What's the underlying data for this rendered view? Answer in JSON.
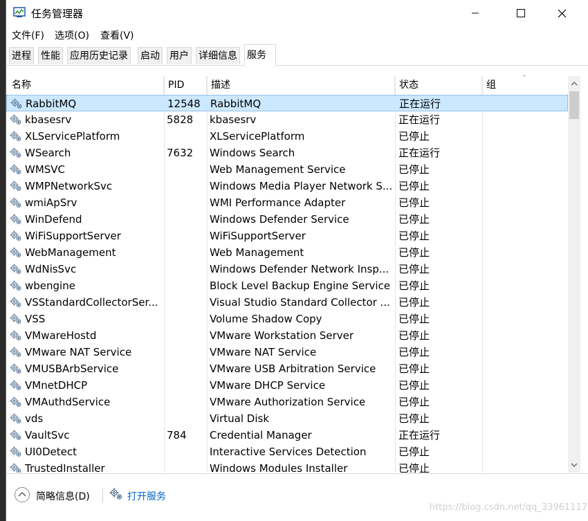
{
  "window": {
    "title": "任务管理器"
  },
  "menu": [
    {
      "label": "文件(F)"
    },
    {
      "label": "选项(O)"
    },
    {
      "label": "查看(V)"
    }
  ],
  "tabs": [
    {
      "label": "进程"
    },
    {
      "label": "性能"
    },
    {
      "label": "应用历史记录"
    },
    {
      "label": "启动"
    },
    {
      "label": "用户"
    },
    {
      "label": "详细信息"
    },
    {
      "label": "服务"
    }
  ],
  "columns": {
    "name": "名称",
    "pid": "PID",
    "desc": "描述",
    "status": "状态",
    "group": "组"
  },
  "services": [
    {
      "name": "RabbitMQ",
      "pid": "12548",
      "desc": "RabbitMQ",
      "status": "正在运行",
      "selected": true
    },
    {
      "name": "kbasesrv",
      "pid": "5828",
      "desc": "kbasesrv",
      "status": "正在运行"
    },
    {
      "name": "XLServicePlatform",
      "pid": "",
      "desc": "XLServicePlatform",
      "status": "已停止"
    },
    {
      "name": "WSearch",
      "pid": "7632",
      "desc": "Windows Search",
      "status": "正在运行"
    },
    {
      "name": "WMSVC",
      "pid": "",
      "desc": "Web Management Service",
      "status": "已停止"
    },
    {
      "name": "WMPNetworkSvc",
      "pid": "",
      "desc": "Windows Media Player Network S...",
      "status": "已停止"
    },
    {
      "name": "wmiApSrv",
      "pid": "",
      "desc": "WMI Performance Adapter",
      "status": "已停止"
    },
    {
      "name": "WinDefend",
      "pid": "",
      "desc": "Windows Defender Service",
      "status": "已停止"
    },
    {
      "name": "WiFiSupportServer",
      "pid": "",
      "desc": "WiFiSupportServer",
      "status": "已停止"
    },
    {
      "name": "WebManagement",
      "pid": "",
      "desc": "Web Management",
      "status": "已停止"
    },
    {
      "name": "WdNisSvc",
      "pid": "",
      "desc": "Windows Defender Network Insp...",
      "status": "已停止"
    },
    {
      "name": "wbengine",
      "pid": "",
      "desc": "Block Level Backup Engine Service",
      "status": "已停止"
    },
    {
      "name": "VSStandardCollectorSer...",
      "pid": "",
      "desc": "Visual Studio Standard Collector ...",
      "status": "已停止"
    },
    {
      "name": "VSS",
      "pid": "",
      "desc": "Volume Shadow Copy",
      "status": "已停止"
    },
    {
      "name": "VMwareHostd",
      "pid": "",
      "desc": "VMware Workstation Server",
      "status": "已停止"
    },
    {
      "name": "VMware NAT Service",
      "pid": "",
      "desc": "VMware NAT Service",
      "status": "已停止"
    },
    {
      "name": "VMUSBArbService",
      "pid": "",
      "desc": "VMware USB Arbitration Service",
      "status": "已停止"
    },
    {
      "name": "VMnetDHCP",
      "pid": "",
      "desc": "VMware DHCP Service",
      "status": "已停止"
    },
    {
      "name": "VMAuthdService",
      "pid": "",
      "desc": "VMware Authorization Service",
      "status": "已停止"
    },
    {
      "name": "vds",
      "pid": "",
      "desc": "Virtual Disk",
      "status": "已停止"
    },
    {
      "name": "VaultSvc",
      "pid": "784",
      "desc": "Credential Manager",
      "status": "正在运行"
    },
    {
      "name": "UI0Detect",
      "pid": "",
      "desc": "Interactive Services Detection",
      "status": "已停止"
    },
    {
      "name": "TrustedInstaller",
      "pid": "",
      "desc": "Windows Modules Installer",
      "status": "已停止"
    }
  ],
  "footer": {
    "brief": "简略信息(D)",
    "open_services": "打开服务"
  },
  "watermark": "https://blog.csdn.net/qq_33961117",
  "colors": {
    "selected_row": "#cce8ff",
    "link": "#0066cc"
  },
  "icons": {
    "app": "task-manager-icon",
    "service": "gear-icon",
    "minimize": "minimize-icon",
    "maximize": "maximize-icon",
    "close": "close-icon"
  }
}
